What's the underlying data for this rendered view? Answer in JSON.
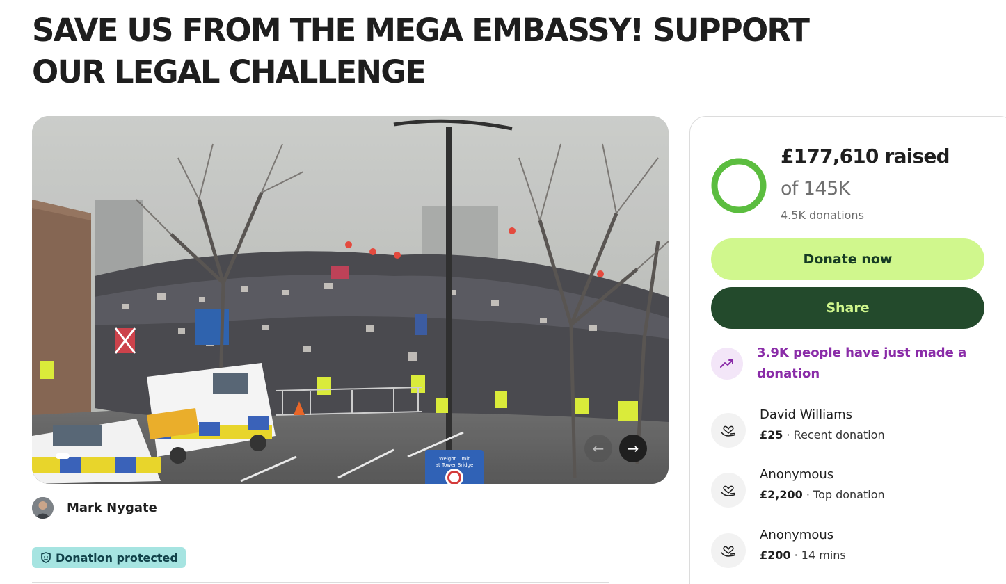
{
  "campaign": {
    "title": "SAVE US FROM THE MEGA EMBASSY! SUPPORT OUR LEGAL CHALLENGE"
  },
  "organiser": {
    "name": "Mark Nygate"
  },
  "badge": {
    "label": "Donation protected",
    "icon": "shield-icon"
  },
  "gallery": {
    "prev_icon": "←",
    "next_icon": "→",
    "sign_lines": [
      "Weight Limit",
      "at Tower Bridge"
    ]
  },
  "progress": {
    "raised": "£177,610 raised",
    "goal": "of 145K",
    "donations": "4.5K donations",
    "fraction": 1.0,
    "color": "#5bbd3f",
    "track_color": "#c9f08d"
  },
  "actions": {
    "donate": "Donate now",
    "share": "Share"
  },
  "trend": {
    "text": "3.9K people have just made a donation",
    "icon": "trend-up-icon"
  },
  "donors": [
    {
      "name": "David Williams",
      "amount": "£25",
      "note": " · Recent donation"
    },
    {
      "name": "Anonymous",
      "amount": "£2,200",
      "note": " · Top donation"
    },
    {
      "name": "Anonymous",
      "amount": "£200",
      "note": " · 14 mins"
    }
  ],
  "colors": {
    "donate_bg": "#d0f78d",
    "share_bg": "#234a2c",
    "trend_text": "#8a2ca8",
    "badge_bg": "#a6e4e1"
  }
}
